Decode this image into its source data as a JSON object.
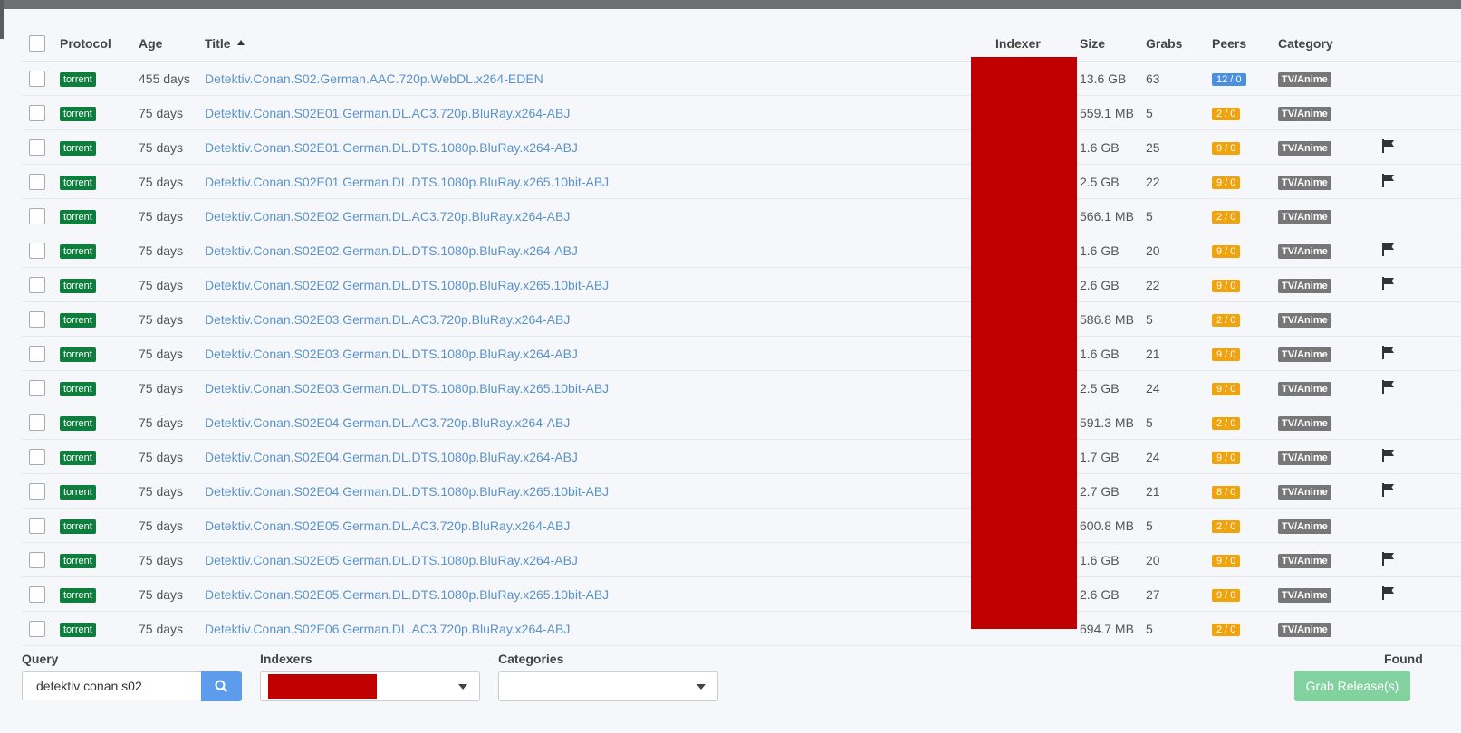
{
  "table": {
    "headers": {
      "protocol": "Protocol",
      "age": "Age",
      "title": "Title",
      "indexer": "Indexer",
      "size": "Size",
      "grabs": "Grabs",
      "peers": "Peers",
      "category": "Category"
    },
    "rows": [
      {
        "protocol": "torrent",
        "age": "455 days",
        "title": "Detektiv.Conan.S02.German.AAC.720p.WebDL.x264-EDEN",
        "size": "13.6 GB",
        "grabs": "63",
        "peers": "12 / 0",
        "peers_color": "#4a8fe0",
        "category": "TV/Anime",
        "flag": false
      },
      {
        "protocol": "torrent",
        "age": "75 days",
        "title": "Detektiv.Conan.S02E01.German.DL.AC3.720p.BluRay.x264-ABJ",
        "size": "559.1 MB",
        "grabs": "5",
        "peers": "2 / 0",
        "peers_color": "#f0a30a",
        "category": "TV/Anime",
        "flag": false
      },
      {
        "protocol": "torrent",
        "age": "75 days",
        "title": "Detektiv.Conan.S02E01.German.DL.DTS.1080p.BluRay.x264-ABJ",
        "size": "1.6 GB",
        "grabs": "25",
        "peers": "9 / 0",
        "peers_color": "#f0a30a",
        "category": "TV/Anime",
        "flag": true
      },
      {
        "protocol": "torrent",
        "age": "75 days",
        "title": "Detektiv.Conan.S02E01.German.DL.DTS.1080p.BluRay.x265.10bit-ABJ",
        "size": "2.5 GB",
        "grabs": "22",
        "peers": "9 / 0",
        "peers_color": "#f0a30a",
        "category": "TV/Anime",
        "flag": true
      },
      {
        "protocol": "torrent",
        "age": "75 days",
        "title": "Detektiv.Conan.S02E02.German.DL.AC3.720p.BluRay.x264-ABJ",
        "size": "566.1 MB",
        "grabs": "5",
        "peers": "2 / 0",
        "peers_color": "#f0a30a",
        "category": "TV/Anime",
        "flag": false
      },
      {
        "protocol": "torrent",
        "age": "75 days",
        "title": "Detektiv.Conan.S02E02.German.DL.DTS.1080p.BluRay.x264-ABJ",
        "size": "1.6 GB",
        "grabs": "20",
        "peers": "9 / 0",
        "peers_color": "#f0a30a",
        "category": "TV/Anime",
        "flag": true
      },
      {
        "protocol": "torrent",
        "age": "75 days",
        "title": "Detektiv.Conan.S02E02.German.DL.DTS.1080p.BluRay.x265.10bit-ABJ",
        "size": "2.6 GB",
        "grabs": "22",
        "peers": "9 / 0",
        "peers_color": "#f0a30a",
        "category": "TV/Anime",
        "flag": true
      },
      {
        "protocol": "torrent",
        "age": "75 days",
        "title": "Detektiv.Conan.S02E03.German.DL.AC3.720p.BluRay.x264-ABJ",
        "size": "586.8 MB",
        "grabs": "5",
        "peers": "2 / 0",
        "peers_color": "#f0a30a",
        "category": "TV/Anime",
        "flag": false
      },
      {
        "protocol": "torrent",
        "age": "75 days",
        "title": "Detektiv.Conan.S02E03.German.DL.DTS.1080p.BluRay.x264-ABJ",
        "size": "1.6 GB",
        "grabs": "21",
        "peers": "9 / 0",
        "peers_color": "#f0a30a",
        "category": "TV/Anime",
        "flag": true
      },
      {
        "protocol": "torrent",
        "age": "75 days",
        "title": "Detektiv.Conan.S02E03.German.DL.DTS.1080p.BluRay.x265.10bit-ABJ",
        "size": "2.5 GB",
        "grabs": "24",
        "peers": "9 / 0",
        "peers_color": "#f0a30a",
        "category": "TV/Anime",
        "flag": true
      },
      {
        "protocol": "torrent",
        "age": "75 days",
        "title": "Detektiv.Conan.S02E04.German.DL.AC3.720p.BluRay.x264-ABJ",
        "size": "591.3 MB",
        "grabs": "5",
        "peers": "2 / 0",
        "peers_color": "#f0a30a",
        "category": "TV/Anime",
        "flag": false
      },
      {
        "protocol": "torrent",
        "age": "75 days",
        "title": "Detektiv.Conan.S02E04.German.DL.DTS.1080p.BluRay.x264-ABJ",
        "size": "1.7 GB",
        "grabs": "24",
        "peers": "9 / 0",
        "peers_color": "#f0a30a",
        "category": "TV/Anime",
        "flag": true
      },
      {
        "protocol": "torrent",
        "age": "75 days",
        "title": "Detektiv.Conan.S02E04.German.DL.DTS.1080p.BluRay.x265.10bit-ABJ",
        "size": "2.7 GB",
        "grabs": "21",
        "peers": "8 / 0",
        "peers_color": "#f0a30a",
        "category": "TV/Anime",
        "flag": true
      },
      {
        "protocol": "torrent",
        "age": "75 days",
        "title": "Detektiv.Conan.S02E05.German.DL.AC3.720p.BluRay.x264-ABJ",
        "size": "600.8 MB",
        "grabs": "5",
        "peers": "2 / 0",
        "peers_color": "#f0a30a",
        "category": "TV/Anime",
        "flag": false
      },
      {
        "protocol": "torrent",
        "age": "75 days",
        "title": "Detektiv.Conan.S02E05.German.DL.DTS.1080p.BluRay.x264-ABJ",
        "size": "1.6 GB",
        "grabs": "20",
        "peers": "9 / 0",
        "peers_color": "#f0a30a",
        "category": "TV/Anime",
        "flag": true
      },
      {
        "protocol": "torrent",
        "age": "75 days",
        "title": "Detektiv.Conan.S02E05.German.DL.DTS.1080p.BluRay.x265.10bit-ABJ",
        "size": "2.6 GB",
        "grabs": "27",
        "peers": "9 / 0",
        "peers_color": "#f0a30a",
        "category": "TV/Anime",
        "flag": true
      },
      {
        "protocol": "torrent",
        "age": "75 days",
        "title": "Detektiv.Conan.S02E06.German.DL.AC3.720p.BluRay.x264-ABJ",
        "size": "694.7 MB",
        "grabs": "5",
        "peers": "2 / 0",
        "peers_color": "#f0a30a",
        "category": "TV/Anime",
        "flag": false
      }
    ]
  },
  "footer": {
    "query_label": "Query",
    "query_value": "detektiv conan s02",
    "indexers_label": "Indexers",
    "categories_label": "Categories",
    "found_label": "Found",
    "grab_label": "Grab Release(s)"
  },
  "colors": {
    "protocol_badge": "#0e7e3c",
    "link": "#5b93c9",
    "redaction": "#c00000",
    "grab_button": "#82d29f",
    "search_button": "#5d9cec"
  },
  "icons": {
    "search": "search-icon",
    "flag": "flag-icon",
    "sort": "sort-ascending-icon",
    "dropdown": "chevron-down-icon"
  }
}
